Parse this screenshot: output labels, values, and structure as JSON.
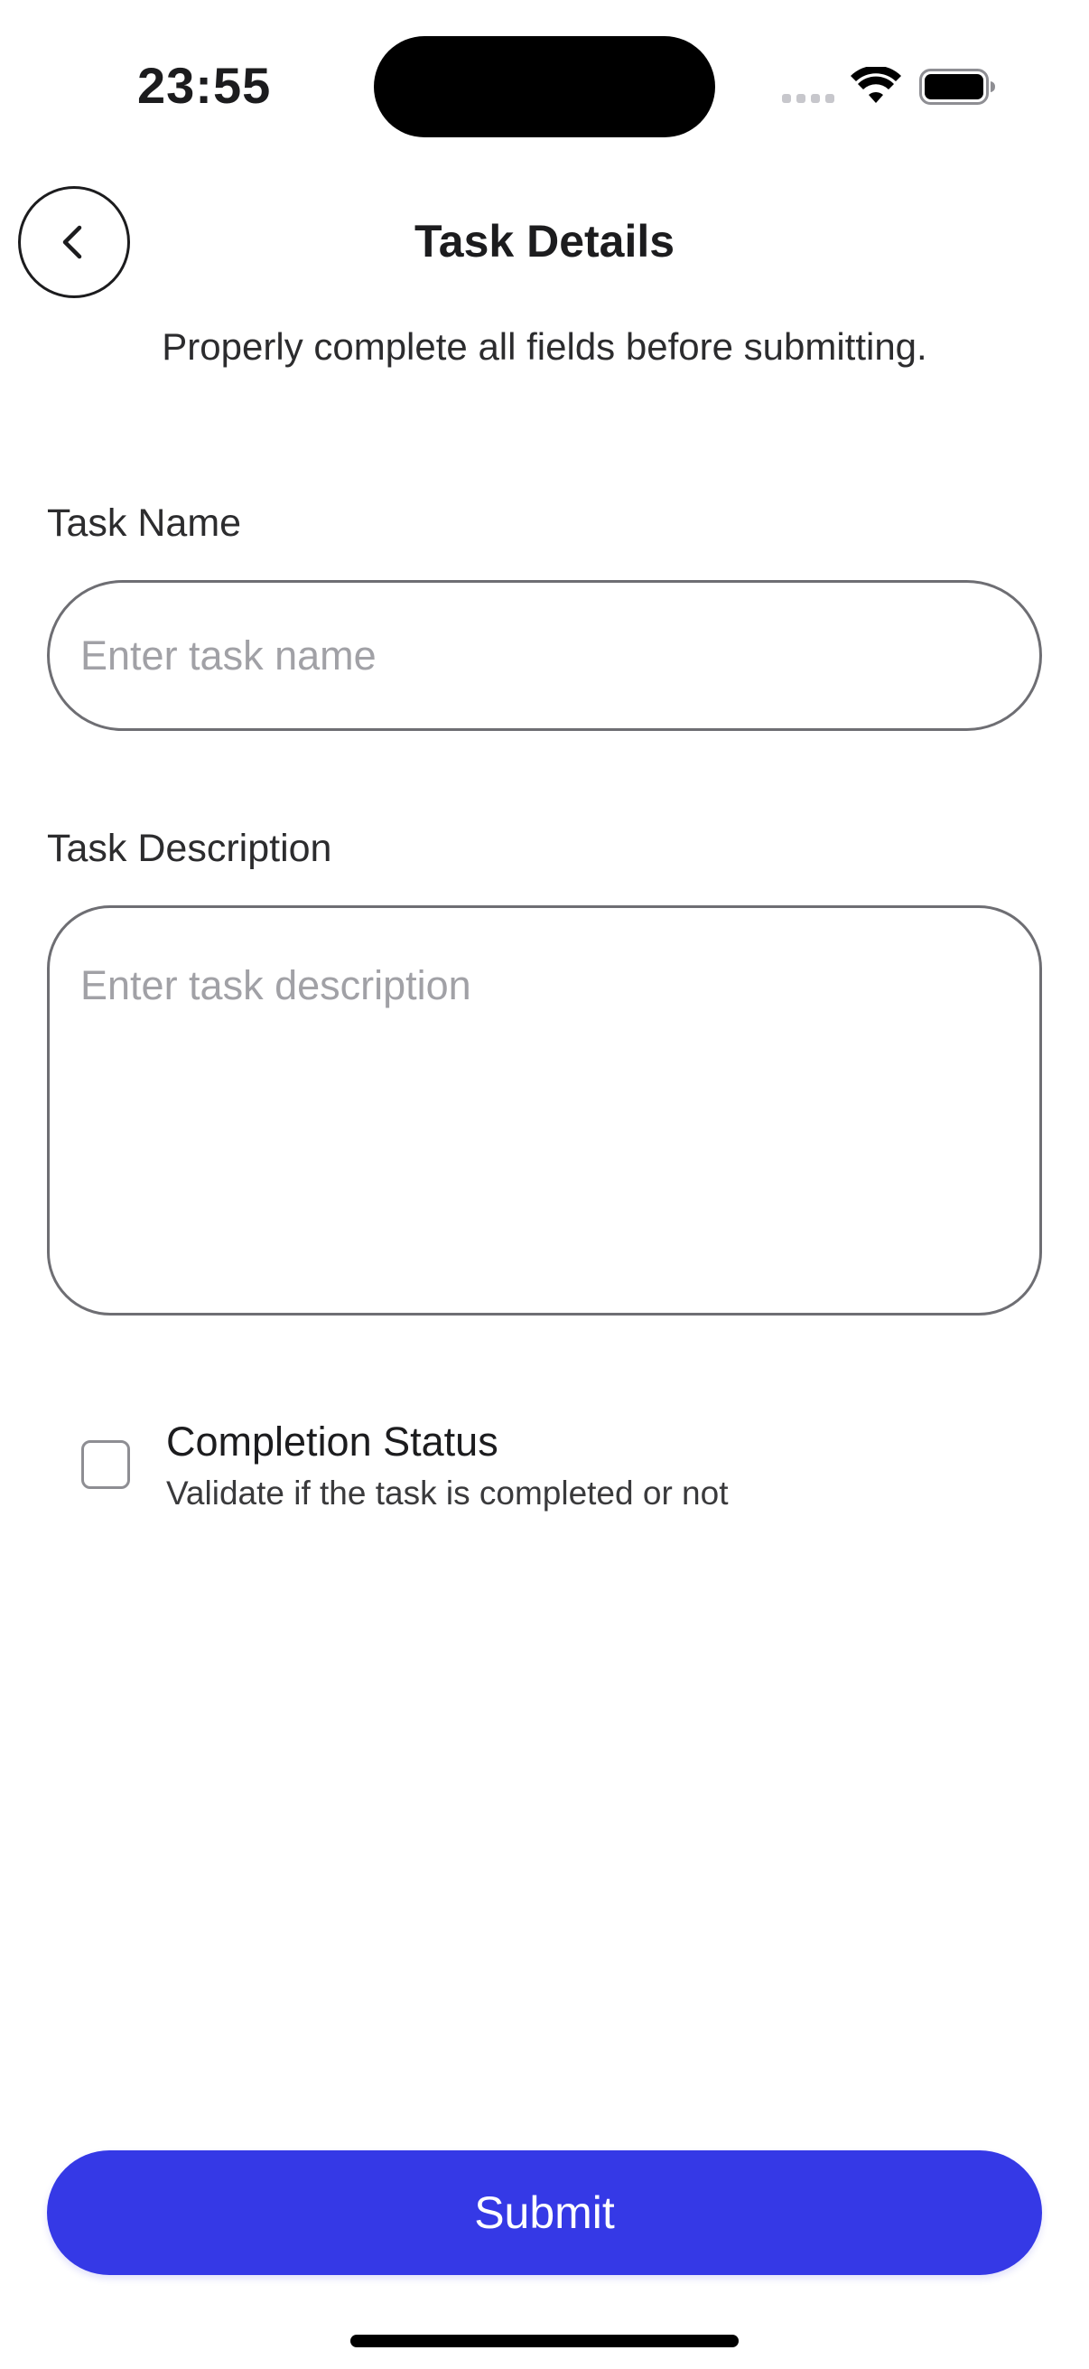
{
  "status_bar": {
    "time": "23:55",
    "icons": [
      "cellular-signal-icon",
      "wifi-icon",
      "battery-icon"
    ]
  },
  "header": {
    "title": "Task Details",
    "subtitle": "Properly complete all fields before submitting.",
    "back_icon": "chevron-left-icon"
  },
  "form": {
    "task_name": {
      "label": "Task Name",
      "value": "",
      "placeholder": "Enter task name"
    },
    "task_description": {
      "label": "Task Description",
      "value": "",
      "placeholder": "Enter task description"
    },
    "completion_status": {
      "title": "Completion Status",
      "help": "Validate if the task is completed or not",
      "checked": false
    }
  },
  "actions": {
    "submit_label": "Submit"
  },
  "colors": {
    "accent": "#3539E6",
    "text": "#1C1C1E",
    "placeholder": "#A1A1A6",
    "border": "#6E6E73"
  }
}
